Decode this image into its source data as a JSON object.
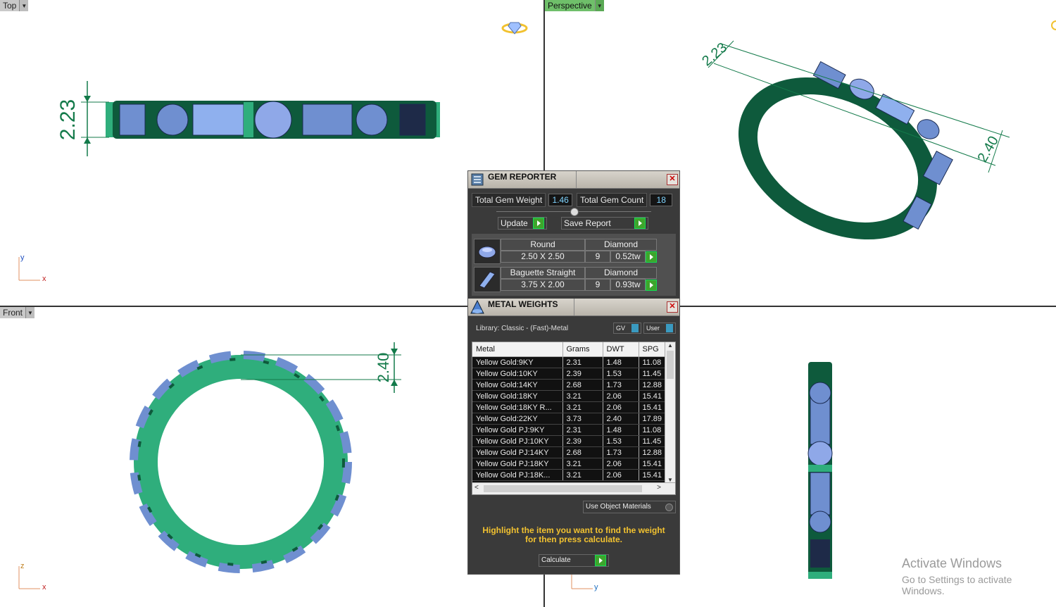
{
  "viewports": {
    "top": {
      "label": "Top",
      "dim": "2.23"
    },
    "perspective": {
      "label": "Perspective",
      "dim1": "2.23",
      "dim2": "2.40"
    },
    "front": {
      "label": "Front",
      "dim": "2.40"
    },
    "right": {
      "label": ""
    }
  },
  "axes": {
    "top": [
      "y",
      "x"
    ],
    "front": [
      "z",
      "x"
    ],
    "right": [
      "z",
      "y"
    ]
  },
  "gem_reporter": {
    "title": "GEM REPORTER",
    "total_weight_label": "Total Gem Weight",
    "total_weight_value": "1.46",
    "total_count_label": "Total Gem Count",
    "total_count_value": "18",
    "update_label": "Update",
    "save_label": "Save Report",
    "gems": [
      {
        "shape": "Round",
        "material": "Diamond",
        "size": "2.50 X 2.50",
        "count": "9",
        "weight": "0.52tw"
      },
      {
        "shape": "Baguette Straight",
        "material": "Diamond",
        "size": "3.75 X 2.00",
        "count": "9",
        "weight": "0.93tw"
      }
    ]
  },
  "metal_weights": {
    "title": "METAL WEIGHTS",
    "library": "Library: Classic - (Fast)-Metal",
    "gv_label": "GV",
    "user_label": "User",
    "columns": [
      "Metal",
      "Grams",
      "DWT",
      "SPG"
    ],
    "rows": [
      [
        "Yellow Gold:9KY",
        "2.31",
        "1.48",
        "11.08"
      ],
      [
        "Yellow Gold:10KY",
        "2.39",
        "1.53",
        "11.45"
      ],
      [
        "Yellow Gold:14KY",
        "2.68",
        "1.73",
        "12.88"
      ],
      [
        "Yellow Gold:18KY",
        "3.21",
        "2.06",
        "15.41"
      ],
      [
        "Yellow Gold:18KY R...",
        "3.21",
        "2.06",
        "15.41"
      ],
      [
        "Yellow Gold:22KY",
        "3.73",
        "2.40",
        "17.89"
      ],
      [
        "Yellow Gold PJ:9KY",
        "2.31",
        "1.48",
        "11.08"
      ],
      [
        "Yellow Gold PJ:10KY",
        "2.39",
        "1.53",
        "11.45"
      ],
      [
        "Yellow Gold PJ:14KY",
        "2.68",
        "1.73",
        "12.88"
      ],
      [
        "Yellow Gold PJ:18KY",
        "3.21",
        "2.06",
        "15.41"
      ],
      [
        "Yellow Gold PJ:18K...",
        "3.21",
        "2.06",
        "15.41"
      ]
    ],
    "use_object_label": "Use Object Materials",
    "instruction": "Highlight the item you want to find the weight for then press calculate.",
    "calculate_label": "Calculate"
  },
  "watermark": {
    "line1": "Activate Windows",
    "line2": "Go to Settings to activate Windows."
  },
  "colors": {
    "ring_dark": "#0e5a3c",
    "ring_light": "#2fae7c",
    "gem": "#6f8fd0",
    "dim": "#137a4a",
    "highlight": "#f2c230"
  }
}
